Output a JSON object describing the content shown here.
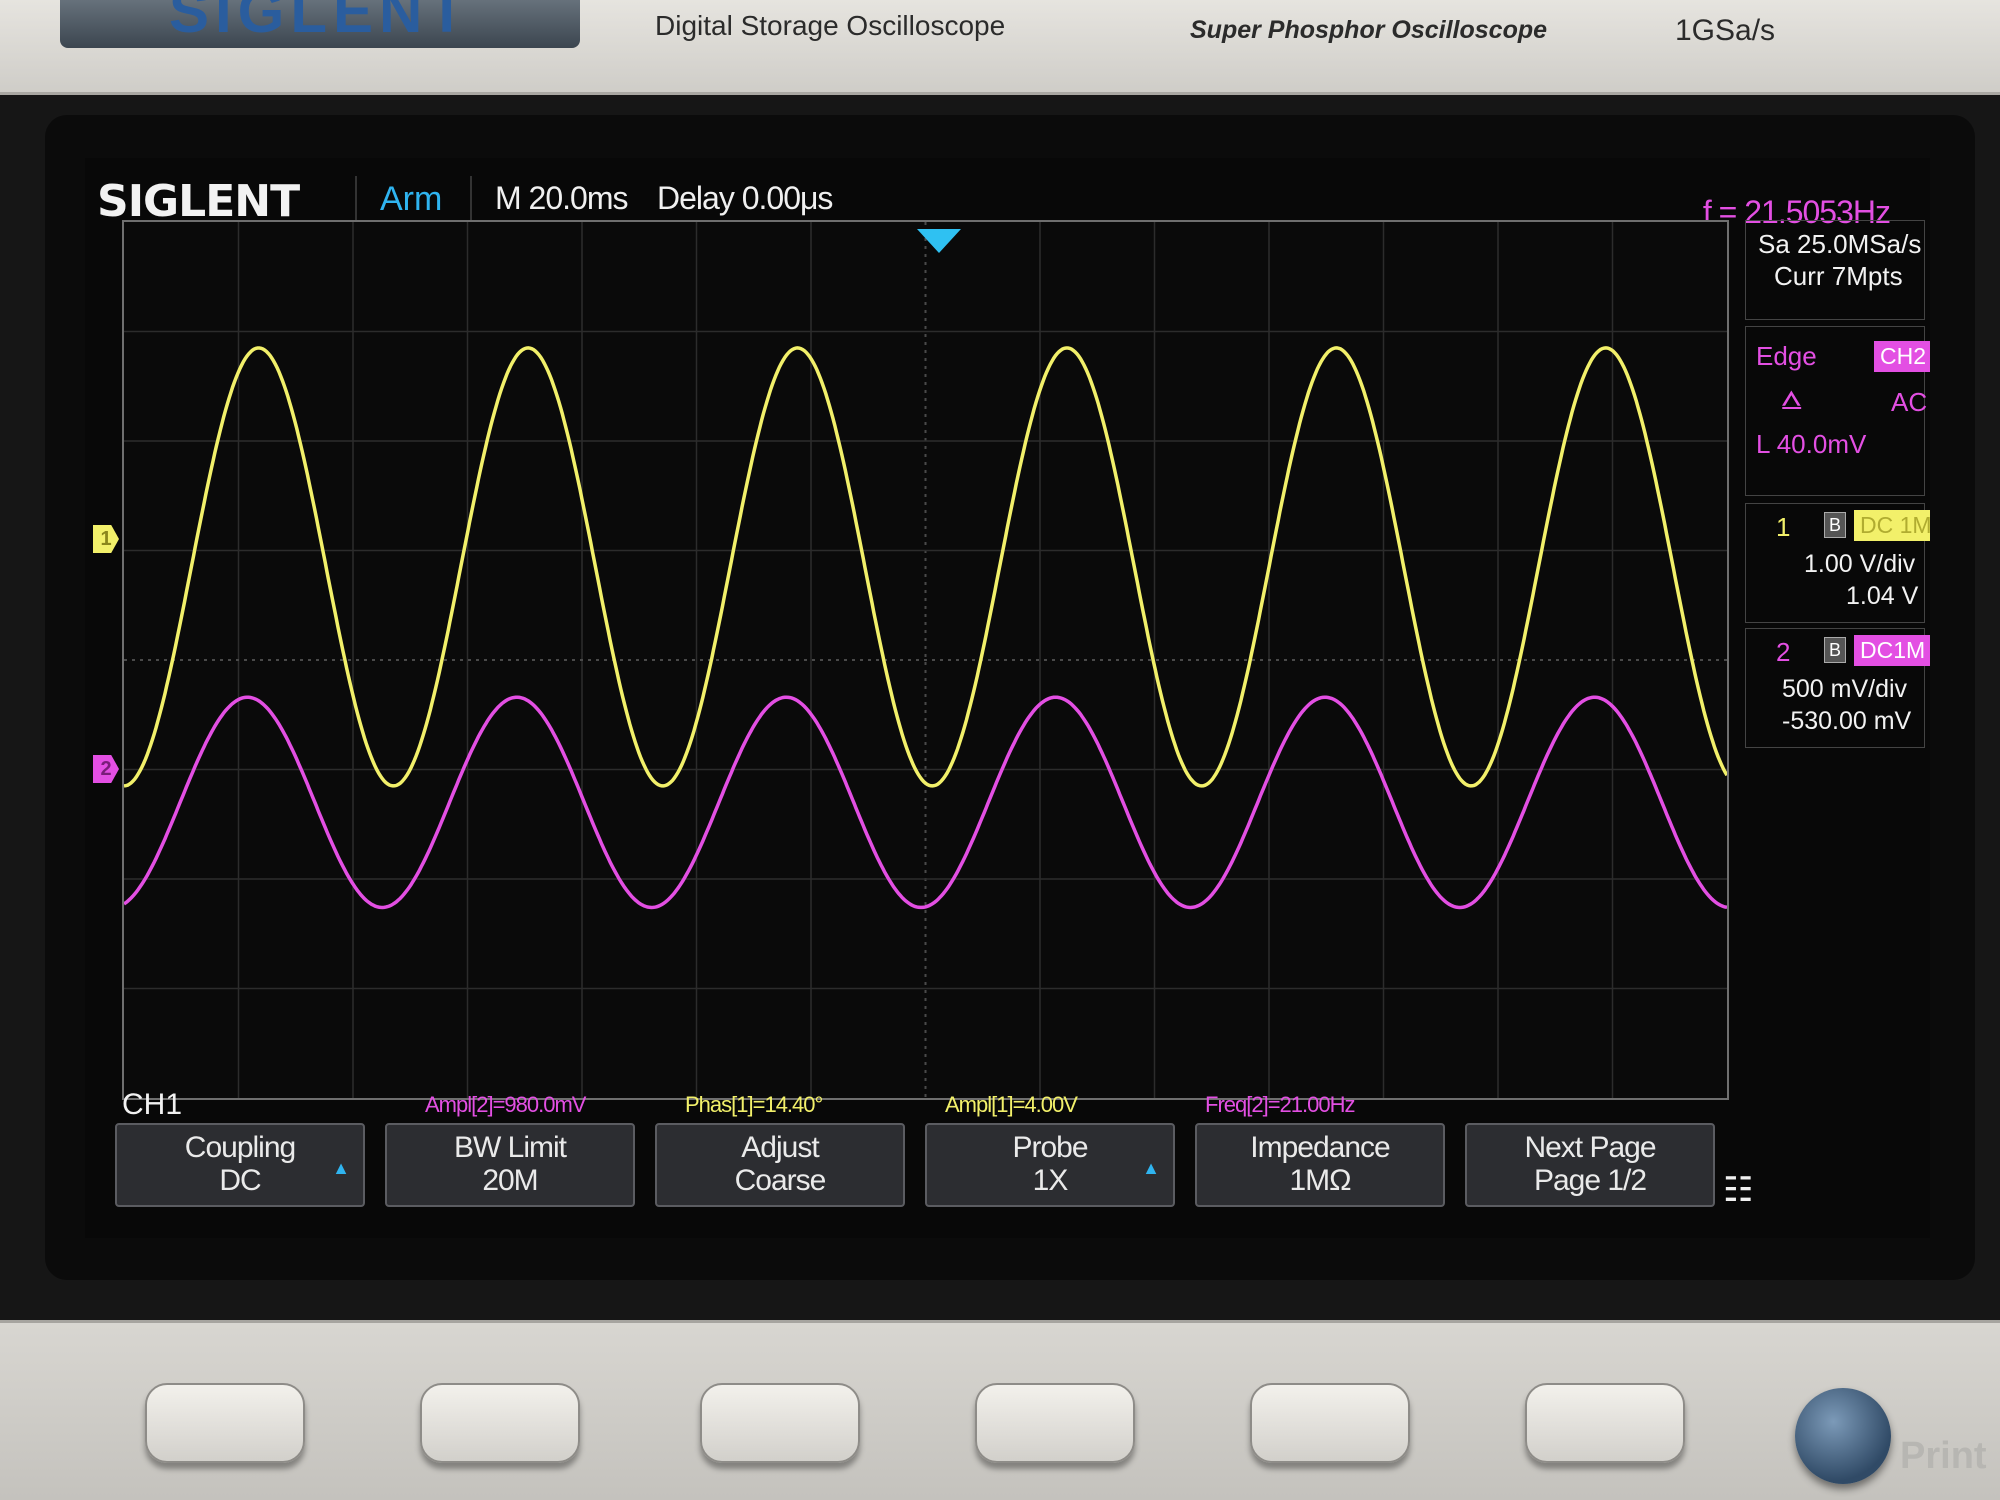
{
  "bezel": {
    "brand": "SIGLENT",
    "model_desc": "Digital Storage Oscilloscope",
    "tagline": "Super Phosphor Oscilloscope",
    "sample_rate_label": "1GSa/s",
    "print_label": "Print"
  },
  "header": {
    "logo": "SIGLENT",
    "status": "Arm",
    "timebase": "M 20.0ms",
    "delay": "Delay 0.00μs",
    "frequency": "f = 21.5053Hz"
  },
  "acquisition": {
    "sample_rate": "Sa 25.0MSa/s",
    "memory": "Curr 7Mpts"
  },
  "trigger": {
    "type": "Edge",
    "source": "CH2",
    "coupling": "AC",
    "level": "L  40.0mV",
    "slope_icon": "rising-edge-icon"
  },
  "channels": [
    {
      "num": "1",
      "coupling": "DC 1M",
      "scale": "1.00 V/div",
      "offset": "1.04 V",
      "color": "#f2f06a",
      "marker": "1"
    },
    {
      "num": "2",
      "coupling": "DC1M",
      "scale": "500 mV/div",
      "offset": "-530.00 mV",
      "color": "#e34fe3",
      "marker": "2"
    }
  ],
  "measurements": {
    "channel_label": "CH1",
    "items": [
      {
        "text": "Ampl[2]=980.0mV",
        "color": "magenta"
      },
      {
        "text": "Phas[1]=14.40°",
        "color": "yellow"
      },
      {
        "text": "Ampl[1]=4.00V",
        "color": "yellow"
      },
      {
        "text": "Freq[2]=21.00Hz",
        "color": "magenta"
      }
    ]
  },
  "menu": {
    "buttons": [
      {
        "l1": "Coupling",
        "l2": "DC",
        "arrow": true
      },
      {
        "l1": "BW Limit",
        "l2": "20M",
        "arrow": false
      },
      {
        "l1": "Adjust",
        "l2": "Coarse",
        "arrow": false
      },
      {
        "l1": "Probe",
        "l2": "1X",
        "arrow": true
      },
      {
        "l1": "Impedance",
        "l2": "1MΩ",
        "arrow": false
      },
      {
        "l1": "Next Page",
        "l2": "Page 1/2",
        "arrow": false
      }
    ],
    "network_icon": "network-icon"
  },
  "chart_data": {
    "type": "line",
    "title": "",
    "xlabel": "",
    "ylabel": "",
    "grid": true,
    "x_divisions": 14,
    "y_divisions": 8,
    "series": [
      {
        "name": "CH1",
        "color": "#f2f06a",
        "frequency_hz": 21.0,
        "amplitude_div": 2.0,
        "center_div": 0.85,
        "cycles_visible": 5.95,
        "phase_start_deg": 180
      },
      {
        "name": "CH2",
        "color": "#e34fe3",
        "frequency_hz": 21.0,
        "amplitude_div": 0.96,
        "center_div": -1.3,
        "cycles_visible": 5.95,
        "phase_start_deg": 195
      }
    ]
  }
}
